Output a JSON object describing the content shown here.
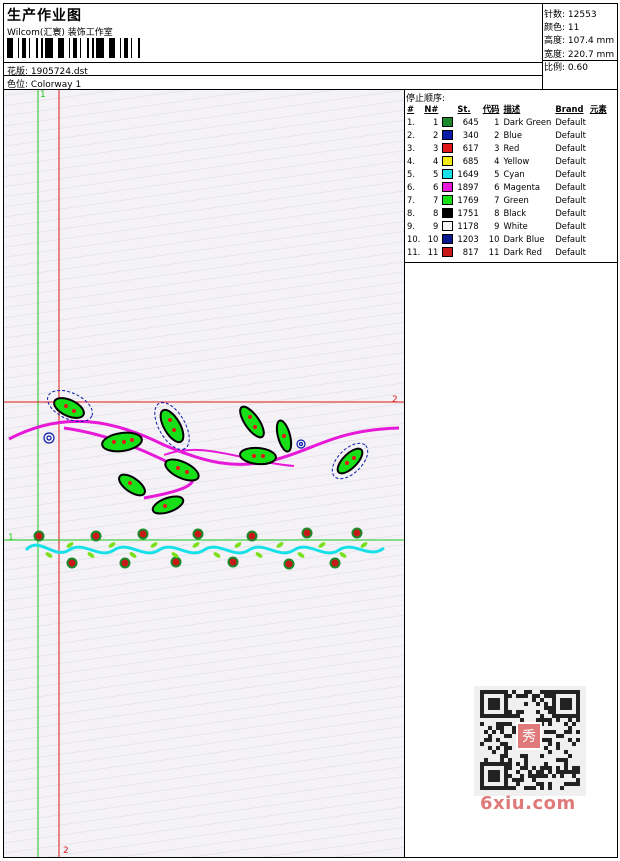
{
  "header": {
    "title": "生产作业图",
    "company": "Wilcom(汇寰) 装饰工作室",
    "design_label": "花版:",
    "design_value": "1905724.dst",
    "colorway_label": "色位:",
    "colorway_value": "Colorway 1"
  },
  "stats": {
    "stitches_label": "针数:",
    "stitches_value": "12553",
    "colors_label": "颜色:",
    "colors_value": "11",
    "height_label": "高度:",
    "height_value": "107.4 mm",
    "width_label": "宽度:",
    "width_value": "220.7 mm",
    "scale_label": "比例:",
    "scale_value": "0.60"
  },
  "stop_sequence": {
    "title": "停止顺序:",
    "headers": [
      "#",
      "N#",
      "St.",
      "代码",
      "描述",
      "Brand",
      "元素"
    ],
    "rows": [
      {
        "idx": "1.",
        "n": "1",
        "color": "#1a8a2a",
        "st": "645",
        "code": "1",
        "desc": "Dark Green",
        "brand": "Default"
      },
      {
        "idx": "2.",
        "n": "2",
        "color": "#0a1aa8",
        "st": "340",
        "code": "2",
        "desc": "Blue",
        "brand": "Default"
      },
      {
        "idx": "3.",
        "n": "3",
        "color": "#e01818",
        "st": "617",
        "code": "3",
        "desc": "Red",
        "brand": "Default"
      },
      {
        "idx": "4.",
        "n": "4",
        "color": "#f2ea10",
        "st": "685",
        "code": "4",
        "desc": "Yellow",
        "brand": "Default"
      },
      {
        "idx": "5.",
        "n": "5",
        "color": "#18e0e8",
        "st": "1649",
        "code": "5",
        "desc": "Cyan",
        "brand": "Default"
      },
      {
        "idx": "6.",
        "n": "6",
        "color": "#e818d8",
        "st": "1897",
        "code": "6",
        "desc": "Magenta",
        "brand": "Default"
      },
      {
        "idx": "7.",
        "n": "7",
        "color": "#18e018",
        "st": "1769",
        "code": "7",
        "desc": "Green",
        "brand": "Default"
      },
      {
        "idx": "8.",
        "n": "8",
        "color": "#000000",
        "st": "1751",
        "code": "8",
        "desc": "Black",
        "brand": "Default"
      },
      {
        "idx": "9.",
        "n": "9",
        "color": "#f4f4f4",
        "st": "1178",
        "code": "9",
        "desc": "White",
        "brand": "Default"
      },
      {
        "idx": "10.",
        "n": "10",
        "color": "#0a1890",
        "st": "1203",
        "code": "10",
        "desc": "Dark Blue",
        "brand": "Default"
      },
      {
        "idx": "11.",
        "n": "11",
        "color": "#c81818",
        "st": "817",
        "code": "11",
        "desc": "Dark Red",
        "brand": "Default"
      }
    ]
  },
  "markers": {
    "top_1": "1",
    "right_2": "2",
    "left_1": "1",
    "bottom_2": "2"
  },
  "watermark": {
    "domain": "6xiu.com",
    "seal_text": "秀"
  },
  "colors": {
    "guide_green": "#18c818",
    "guide_red": "#e01818"
  }
}
